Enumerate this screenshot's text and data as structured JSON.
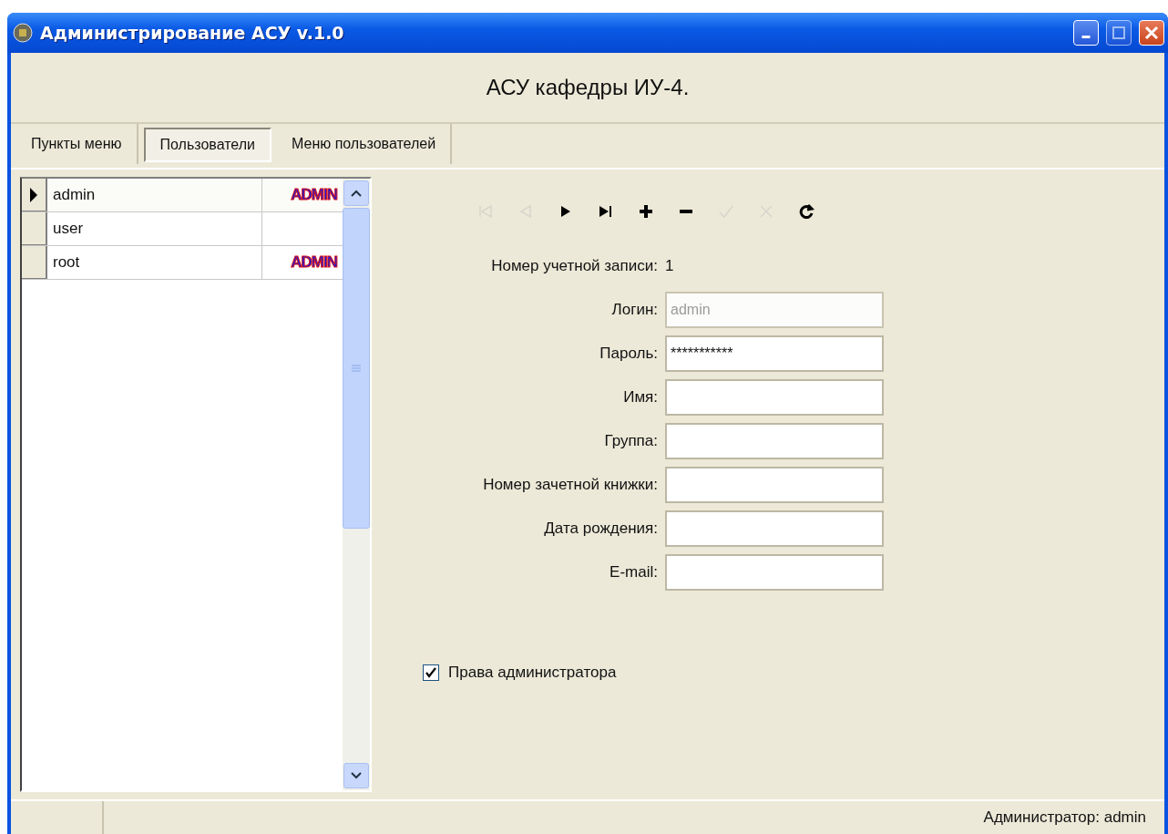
{
  "window": {
    "title": "Администрирование АСУ v.1.0"
  },
  "header": "АСУ кафедры ИУ-4.",
  "tabs": [
    {
      "label": "Пункты меню",
      "selected": false
    },
    {
      "label": "Пользователи",
      "selected": true
    },
    {
      "label": "Меню пользователей",
      "selected": false
    }
  ],
  "users_grid": {
    "rows": [
      {
        "login": "admin",
        "role": "ADMIN",
        "selected": true
      },
      {
        "login": "user",
        "selected": false
      },
      {
        "login": "root",
        "role": "ADMIN",
        "selected": false
      }
    ]
  },
  "navigator": [
    {
      "kind": "first",
      "disabled": true
    },
    {
      "kind": "prior",
      "disabled": true
    },
    {
      "kind": "next",
      "disabled": false
    },
    {
      "kind": "last",
      "disabled": false
    },
    {
      "kind": "insert",
      "disabled": false
    },
    {
      "kind": "delete",
      "disabled": false
    },
    {
      "kind": "post",
      "disabled": true
    },
    {
      "kind": "cancel",
      "disabled": true
    },
    {
      "kind": "refresh",
      "disabled": false
    }
  ],
  "record_number": {
    "label": "Номер учетной записи:",
    "value": "1"
  },
  "fields": [
    {
      "label": "Логин:",
      "value": "admin",
      "disabled": true
    },
    {
      "label": "Пароль:",
      "value": "***********",
      "disabled": false
    },
    {
      "label": "Имя:",
      "disabled": false
    },
    {
      "label": "Группа:",
      "disabled": false
    },
    {
      "label": "Номер зачетной книжки:",
      "disabled": false
    },
    {
      "label": "Дата рождения:",
      "disabled": false
    },
    {
      "label": "E-mail:",
      "disabled": false
    }
  ],
  "admin_rights": {
    "label": "Права администратора",
    "checked": true
  },
  "status_bar": {
    "text": "Администратор: admin"
  }
}
